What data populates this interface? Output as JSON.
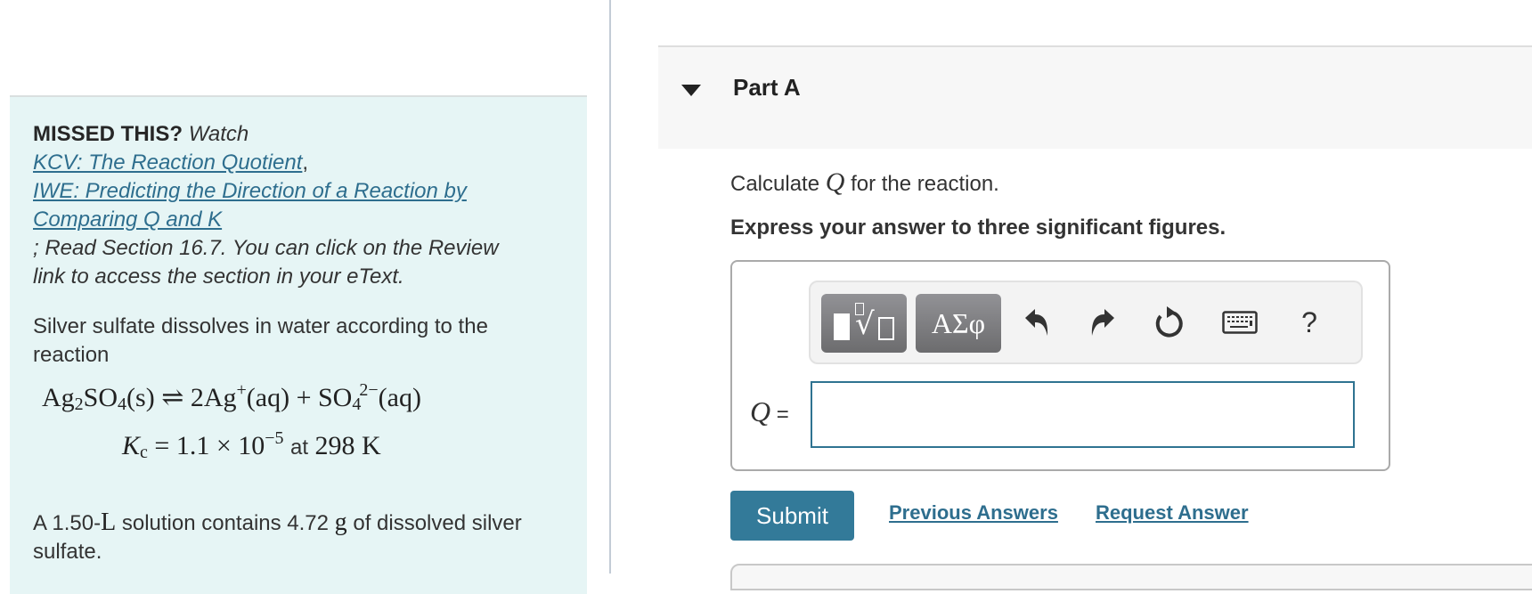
{
  "left_panel": {
    "missed_label": "MISSED THIS?",
    "watch_label": "Watch",
    "links": [
      {
        "label": "KCV: The Reaction Quotient"
      },
      {
        "label": "IWE: Predicting the Direction of a Reaction by Comparing Q and K"
      }
    ],
    "comma": ",",
    "read_text": "; Read Section 16.7. You can click on the Review link to access the section in your eText.",
    "intro_text": "Silver sulfate dissolves in water according to the reaction",
    "equation": {
      "reactant": "Ag",
      "reactant_sub1": "2",
      "reactant_mid": "SO",
      "reactant_sub2": "4",
      "reactant_state": "(s)",
      "arrow": "⇌",
      "product1": "2Ag",
      "product1_charge": "+",
      "product1_state": "(aq)",
      "plus": "+",
      "product2": "SO",
      "product2_sub": "4",
      "product2_charge": "2−",
      "product2_state": "(aq)"
    },
    "kc": {
      "symbol": "K",
      "sub": "c",
      "value": "= 1.1 × 10",
      "exponent": "−5",
      "at_text": "at",
      "temperature": "298 K"
    },
    "solution_text_a": "A 1.50-",
    "solution_unit_L": "L",
    "solution_text_b": " solution contains 4.72 ",
    "solution_unit_g": "g",
    "solution_text_c": " of dissolved silver sulfate."
  },
  "part": {
    "title": "Part A",
    "calc_prefix": "Calculate ",
    "calc_var": "Q",
    "calc_suffix": " for the reaction.",
    "instruction": "Express your answer to three significant figures."
  },
  "toolbar": {
    "greek_label": "ΑΣφ",
    "help_label": "?",
    "icons": [
      "templates-icon",
      "greek-symbols-icon",
      "undo-icon",
      "redo-icon",
      "reset-icon",
      "keyboard-icon",
      "help-icon"
    ]
  },
  "answer": {
    "var_label": "Q",
    "equals": "=",
    "value": "",
    "placeholder": ""
  },
  "actions": {
    "submit_label": "Submit",
    "previous_answers_label": "Previous Answers",
    "request_answer_label": "Request Answer"
  },
  "colors": {
    "accent": "#337a99",
    "link": "#2e6e8e",
    "panel_bg": "#e6f5f5"
  }
}
